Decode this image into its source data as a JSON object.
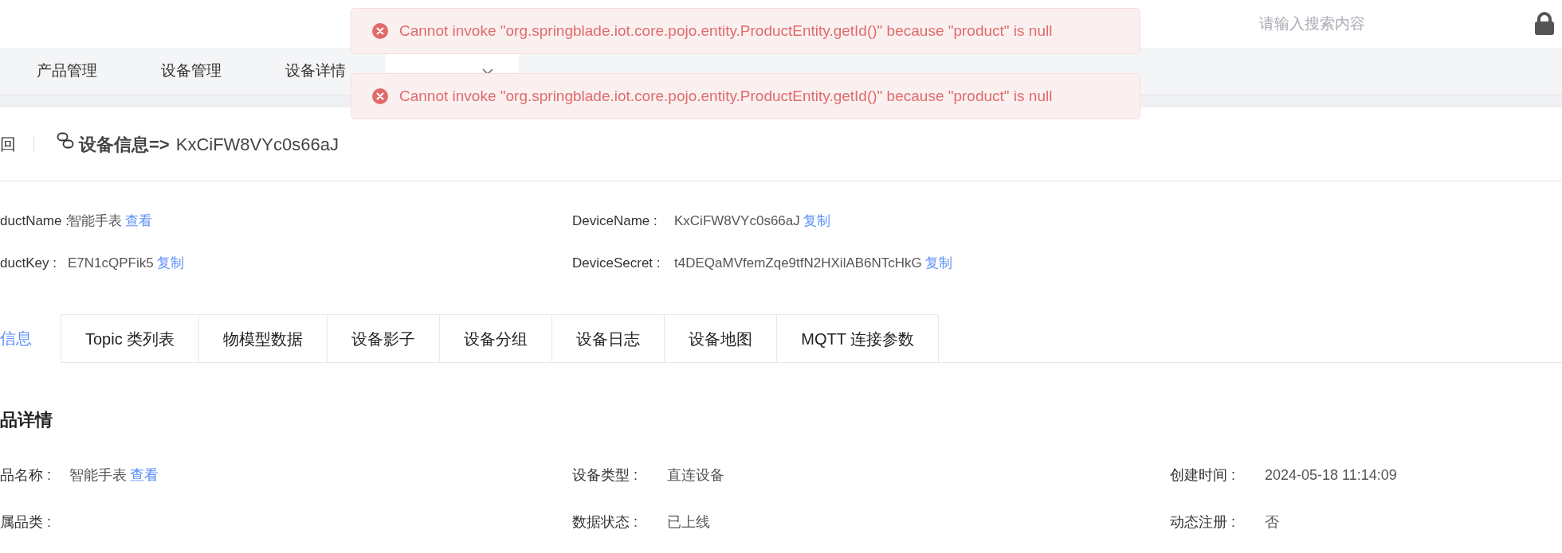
{
  "header": {
    "search": {
      "placeholder": "请输入搜索内容"
    }
  },
  "nav_tabs": [
    {
      "label": "产品管理",
      "selected": false
    },
    {
      "label": "设备管理",
      "selected": false
    },
    {
      "label": "设备详情",
      "selected": false
    },
    {
      "selected": true
    }
  ],
  "toasts": [
    {
      "message": "Cannot invoke \"org.springblade.iot.core.pojo.entity.ProductEntity.getId()\" because \"product\" is null"
    },
    {
      "message": "Cannot invoke \"org.springblade.iot.core.pojo.entity.ProductEntity.getId()\" because \"product\" is null"
    }
  ],
  "page_header": {
    "back": "回",
    "title": "设备信息=>",
    "device": "KxCiFW8VYc0s66aJ"
  },
  "info": [
    {
      "label": "ductName :",
      "value": "智能手表",
      "action": "查看"
    },
    {
      "label": "DeviceName :",
      "value": "KxCiFW8VYc0s66aJ",
      "action": "复制"
    },
    {
      "label": "ductKey :",
      "value": "E7N1cQPFik5",
      "action": "复制"
    },
    {
      "label": "DeviceSecret :",
      "value": "t4DEQaMVfemZqe9tfN2HXilAB6NTcHkG",
      "action": "复制"
    }
  ],
  "tabs": [
    {
      "label": "信息",
      "selected": true
    },
    {
      "label": "Topic 类列表",
      "selected": false
    },
    {
      "label": "物模型数据",
      "selected": false
    },
    {
      "label": "设备影子",
      "selected": false
    },
    {
      "label": "设备分组",
      "selected": false
    },
    {
      "label": "设备日志",
      "selected": false
    },
    {
      "label": "设备地图",
      "selected": false
    },
    {
      "label": "MQTT 连接参数",
      "selected": false
    }
  ],
  "section": {
    "title": "品详情",
    "rows": [
      [
        {
          "label": "品名称 :",
          "value": "智能手表",
          "action": "查看"
        },
        {
          "label": "设备类型 :",
          "value": "直连设备"
        },
        {
          "label": "创建时间 :",
          "value": "2024-05-18 11:14:09"
        }
      ],
      [
        {
          "label": "属品类 :"
        },
        {
          "label": "数据状态 :",
          "value": "已上线"
        },
        {
          "label": "动态注册 :",
          "value": "否"
        }
      ]
    ]
  }
}
